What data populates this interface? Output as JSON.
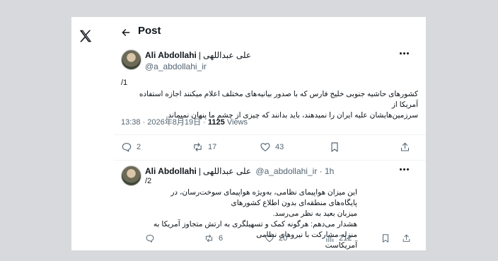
{
  "header": {
    "title": "Post"
  },
  "tweet1": {
    "name": "Ali Abdollahi",
    "sep": "|",
    "name_fa": "علی عبداللهی",
    "handle": "@a_abdollahi_ir",
    "thread_num": "/1",
    "text_line1": "کشورهای حاشیه جنوبی خلیج فارس که با صدور بیانیه‌های مختلف اعلام میکنند اجازه استفاده آمریکا از",
    "text_line2": "سرزمین‌هایشان علیه ایران را نمیدهند، باید بدانند که چیزی از چشم ما پنهان نمیماند.",
    "time": "13:38 · 2026年8月19日 ·",
    "views_count": "1125",
    "views_label": "Views",
    "replies": "2",
    "reposts": "17",
    "likes": "43"
  },
  "tweet2": {
    "name": "Ali Abdollahi",
    "sep": "|",
    "name_fa": "علی عبداللهی",
    "handle_time": "@a_abdollahi_ir · 1h",
    "thread_num": "/2",
    "text_line1": "این میزان هواپیمای نظامی، به‌ویژه هواپیمای سوخت‌رسان، در پایگاه‌های منطقه‌ای بدون اطلاع کشورهای",
    "text_line2": "میزبان بعید به نظر می‌رسد.",
    "text_line3": "هشدار می‌دهم: هرگونه کمک و تسهیلگری به ارتش متجاوز آمریکا به منزله مشارکت با نیروهای نظامی",
    "text_line4": "آمریکاست",
    "replies": "",
    "reposts": "6",
    "likes": "20",
    "views": "212"
  }
}
